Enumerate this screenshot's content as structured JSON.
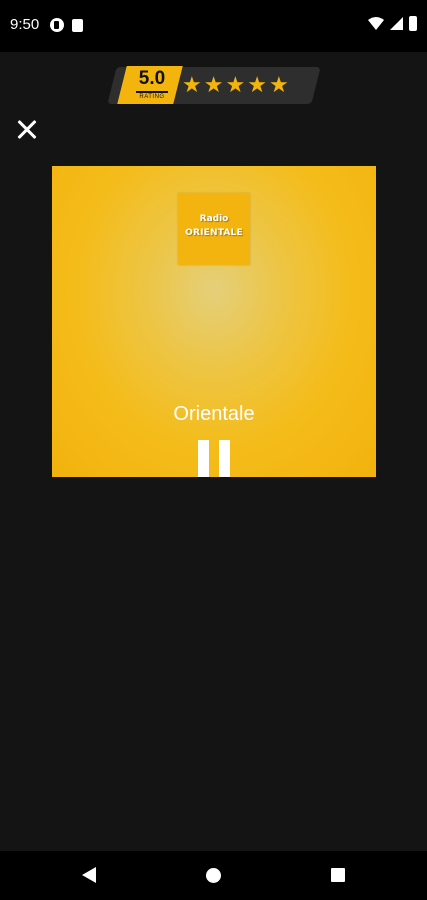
{
  "status_bar": {
    "time": "9:50",
    "icons": [
      "notification-app-icon",
      "sd-card-icon",
      "wifi-icon",
      "cell-signal-icon",
      "battery-icon"
    ]
  },
  "rating": {
    "score": "5.0",
    "label": "RATING",
    "stars": 5,
    "star_glyph": "★",
    "accent_color": "#f3b50d"
  },
  "player": {
    "logo_line1": "Radio",
    "logo_line2": "ORIENTALE",
    "station_name": "Orientale",
    "state": "playing",
    "background_color": "#f3b20d"
  },
  "nav_bar": {
    "buttons": [
      "back-icon",
      "home-icon",
      "recents-icon"
    ]
  }
}
